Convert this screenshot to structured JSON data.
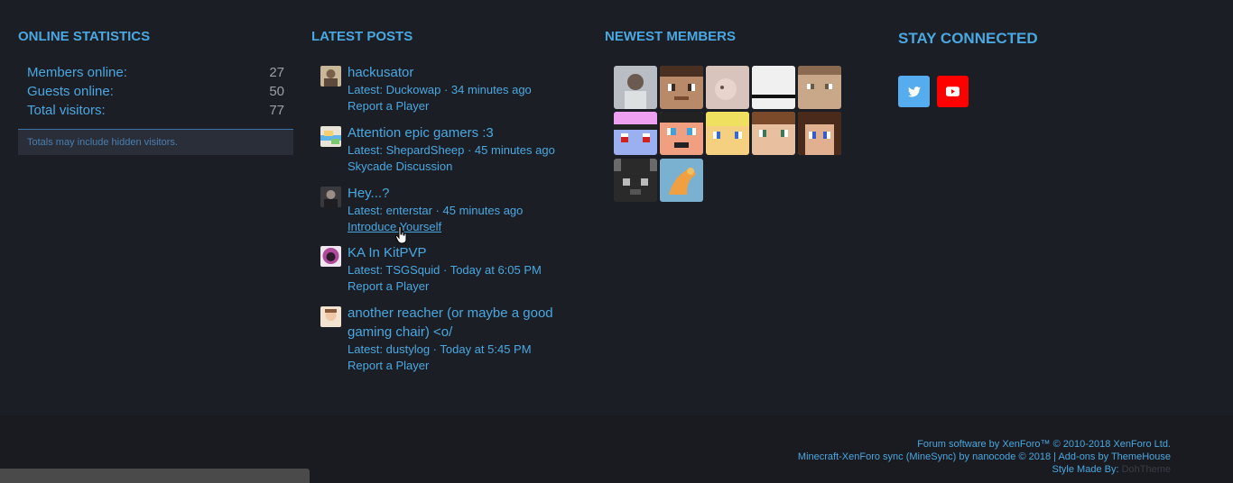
{
  "online_stats": {
    "title": "ONLINE STATISTICS",
    "rows": [
      {
        "label": "Members online:",
        "value": "27"
      },
      {
        "label": "Guests online:",
        "value": "50"
      },
      {
        "label": "Total visitors:",
        "value": "77"
      }
    ],
    "note": "Totals may include hidden visitors."
  },
  "latest_posts": {
    "title": "LATEST POSTS",
    "items": [
      {
        "title": "hackusator",
        "meta": "Latest: Duckowap · 34 minutes ago",
        "forum": "Report a Player"
      },
      {
        "title": "Attention epic gamers :3",
        "meta": "Latest: ShepardSheep · 45 minutes ago",
        "forum": "Skycade Discussion"
      },
      {
        "title": "Hey...?",
        "meta": "Latest: enterstar · 45 minutes ago",
        "forum": "Introduce Yourself"
      },
      {
        "title": "KA In KitPVP",
        "meta": "Latest: TSGSquid · Today at 6:05 PM",
        "forum": "Report a Player"
      },
      {
        "title": "another reacher (or maybe a good gaming chair) <o/",
        "meta": "Latest: dustylog · Today at 5:45 PM",
        "forum": "Report a Player"
      }
    ]
  },
  "newest_members": {
    "title": "NEWEST MEMBERS"
  },
  "stay_connected": {
    "title": "STAY CONNECTED",
    "twitter_color": "#55acee",
    "youtube_color": "#ff0000"
  },
  "footer": {
    "line1": "Forum software by XenForo™ © 2010-2018 XenForo Ltd.",
    "line2": "Minecraft-XenForo sync (MineSync) by nanocode © 2018 | Add-ons by ThemeHouse",
    "line3_label": "Style Made By:",
    "line3_author": "DohTheme"
  }
}
